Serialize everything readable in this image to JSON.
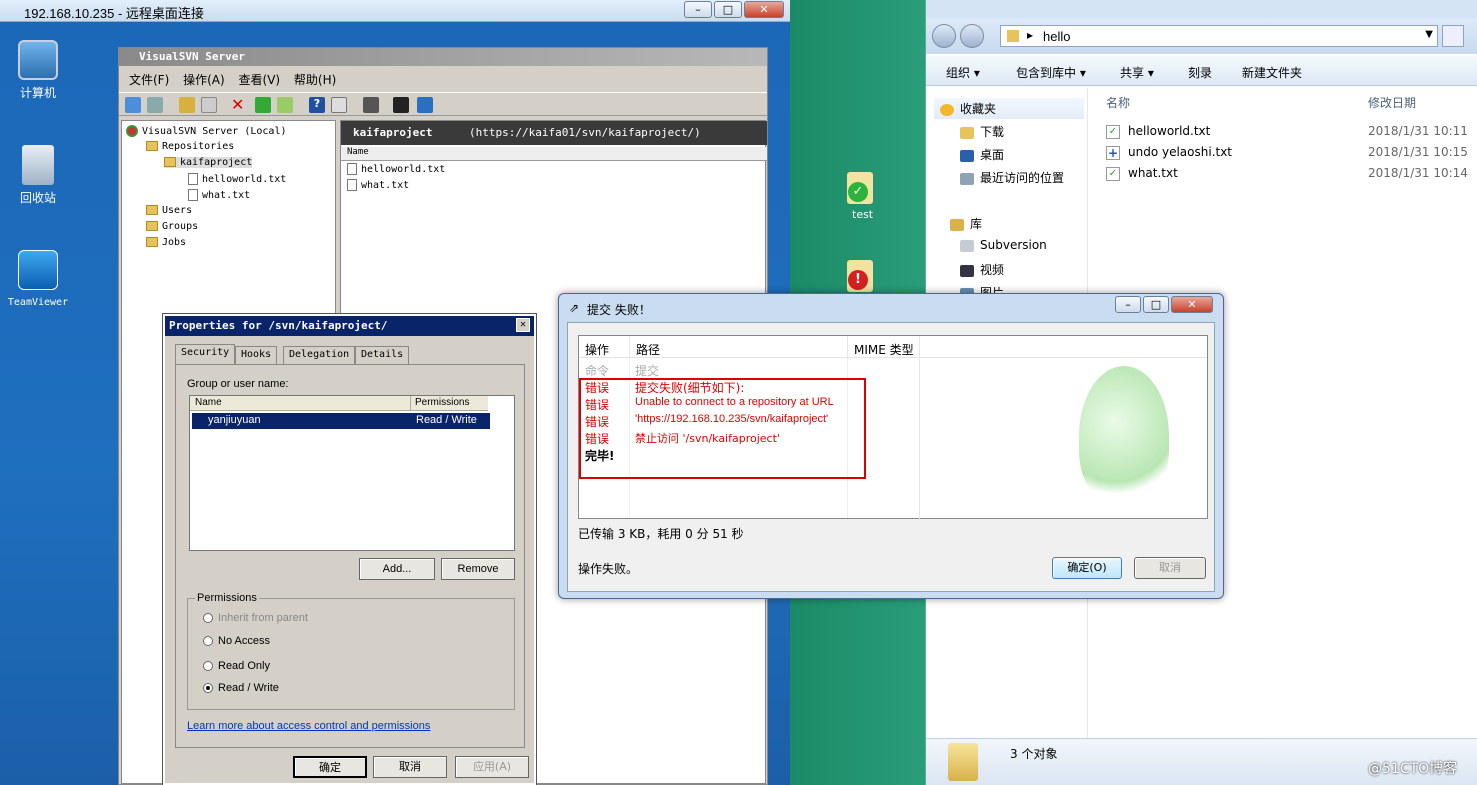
{
  "rdp": {
    "title": "192.168.10.235 - 远程桌面连接"
  },
  "desktop": {
    "icons": [
      "计算机",
      "回收站",
      "TeamViewer"
    ],
    "test_icon": "test"
  },
  "vsvn": {
    "title": "VisualSVN Server",
    "menu": [
      "文件(F)",
      "操作(A)",
      "查看(V)",
      "帮助(H)"
    ],
    "tree": {
      "root": "VisualSVN Server (Local)",
      "repositories": "Repositories",
      "project": "kaifaproject",
      "files": [
        "helloworld.txt",
        "what.txt"
      ],
      "users": "Users",
      "groups": "Groups",
      "jobs": "Jobs"
    },
    "header_name": "kaifaproject",
    "header_url": "(https://kaifa01/svn/kaifaproject/)",
    "col_name": "Name",
    "files": [
      "helloworld.txt",
      "what.txt"
    ]
  },
  "props": {
    "title": "Properties for /svn/kaifaproject/",
    "tabs": [
      "Security",
      "Hooks",
      "Delegation",
      "Details"
    ],
    "group_label": "Group or user name:",
    "col_name": "Name",
    "col_perm": "Permissions",
    "user": "yanjiuyuan",
    "user_perm": "Read / Write",
    "add": "Add...",
    "remove": "Remove",
    "perm_group": "Permissions",
    "options": [
      "Inherit from parent",
      "No Access",
      "Read Only",
      "Read / Write"
    ],
    "selected": 3,
    "link": "Learn more about access control and permissions",
    "ok": "确定",
    "cancel": "取消",
    "apply": "应用(A)"
  },
  "explorer": {
    "path": "hello",
    "cmd": [
      "组织 ▾",
      "包含到库中 ▾",
      "共享 ▾",
      "刻录",
      "新建文件夹"
    ],
    "nav": [
      "收藏夹",
      "下载",
      "桌面",
      "最近访问的位置",
      "库",
      "Subversion",
      "视频",
      "图片"
    ],
    "col_name": "名称",
    "col_date": "修改日期",
    "files": [
      {
        "name": "helloworld.txt",
        "date": "2018/1/31 10:11"
      },
      {
        "name": "undo yelaoshi.txt",
        "date": "2018/1/31 10:15"
      },
      {
        "name": "what.txt",
        "date": "2018/1/31 10:14"
      }
    ],
    "status": "3 个对象"
  },
  "commit": {
    "title": "提交 失败！",
    "col_action": "操作",
    "col_path": "路径",
    "col_mime": "MIME 类型",
    "rows": [
      {
        "action": "命令",
        "path": "提交",
        "kind": "gray"
      },
      {
        "action": "错误",
        "path": "提交失败(细节如下):",
        "kind": "red"
      },
      {
        "action": "错误",
        "path": "Unable to connect to a repository at URL",
        "kind": "red"
      },
      {
        "action": "错误",
        "path": "'https://192.168.10.235/svn/kaifaproject'",
        "kind": "red"
      },
      {
        "action": "错误",
        "path": "禁止访问 '/svn/kaifaproject'",
        "kind": "red"
      },
      {
        "action": "完毕!",
        "path": "",
        "kind": "black"
      }
    ],
    "transfer": "已传输 3 KB，耗用 0 分 51 秒",
    "status": "操作失败。",
    "ok": "确定(O)",
    "cancel": "取消"
  },
  "watermark": "@51CTO博客"
}
